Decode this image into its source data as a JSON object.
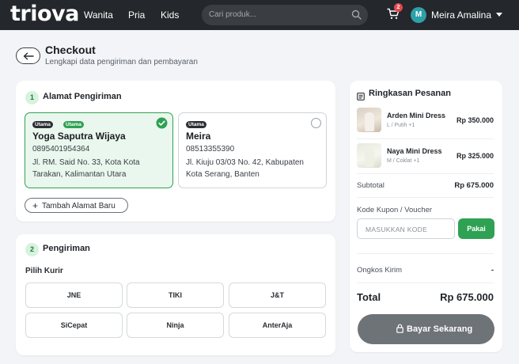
{
  "header": {
    "logo": "triova",
    "nav": [
      "Wanita",
      "Pria",
      "Kids"
    ],
    "search_placeholder": "Cari produk...",
    "cart_count": "2",
    "user_initial": "M",
    "user_name": "Meira Amalina"
  },
  "page": {
    "title": "Checkout",
    "subtitle": "Lengkapi data pengiriman dan pembayaran"
  },
  "address_section": {
    "step": "1",
    "title": "Alamat Pengiriman",
    "addresses": [
      {
        "badges": [
          "Utama",
          "Utama"
        ],
        "name": "Yoga Saputra Wijaya",
        "phone": "0895401954364",
        "line1": "Jl. RM. Said No. 33, Kota Kota",
        "line2": "Tarakan, Kalimantan Utara",
        "selected": true
      },
      {
        "badges": [
          "Utama"
        ],
        "name": "Meira",
        "phone": "08513355390",
        "line1": "Jl. Kiuju 03/03 No. 42, Kabupaten",
        "line2": "Kota Serang, Banten",
        "selected": false
      }
    ],
    "add_button": "Tambah Alamat Baru"
  },
  "shipping_section": {
    "step": "2",
    "title": "Pengiriman",
    "courier_label": "Pilih Kurir",
    "couriers": [
      "JNE",
      "TIKI",
      "J&T",
      "SiCepat",
      "Ninja",
      "AnterAja"
    ]
  },
  "summary": {
    "title": "Ringkasan Pesanan",
    "items": [
      {
        "name": "Arden Mini Dress",
        "variant": "L / Putih +1",
        "price": "Rp 350.000"
      },
      {
        "name": "Naya Mini Dress",
        "variant": "M / Coklat +1",
        "price": "Rp 325.000"
      }
    ],
    "subtotal_label": "Subtotal",
    "subtotal_value": "Rp 675.000",
    "coupon_label": "Kode Kupon / Voucher",
    "coupon_placeholder": "MASUKKAN KODE",
    "coupon_button": "Pakai",
    "shipping_label": "Ongkos Kirim",
    "shipping_value": "-",
    "total_label": "Total",
    "total_value": "Rp 675.000",
    "pay_button": "Bayar Sekarang"
  },
  "colors": {
    "accent_green": "#2fa152",
    "topbar": "#24272b",
    "pay_button": "#6e7378"
  }
}
